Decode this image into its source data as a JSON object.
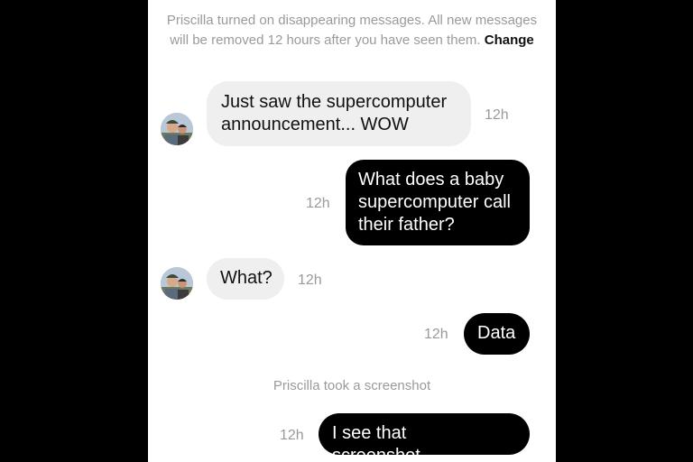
{
  "notice": {
    "text": "Priscilla turned on disappearing messages. All new messages will be removed 12 hours after you have seen them.",
    "action_label": "Change"
  },
  "messages": [
    {
      "sender": "Priscilla",
      "direction": "incoming",
      "text": "Just saw the supercomputer announcement... WOW",
      "time": "12h"
    },
    {
      "sender": "me",
      "direction": "outgoing",
      "text": "What does a baby supercomputer call their father?",
      "time": "12h"
    },
    {
      "sender": "Priscilla",
      "direction": "incoming",
      "text": "What?",
      "time": "12h"
    },
    {
      "sender": "me",
      "direction": "outgoing",
      "text": "Data",
      "time": "12h"
    },
    {
      "sender": "me",
      "direction": "outgoing",
      "text": "I see that screenshot…",
      "time": "12h"
    }
  ],
  "system_event": "Priscilla took a screenshot",
  "colors": {
    "incoming_bubble": "#efefef",
    "outgoing_bubble": "#000000",
    "timestamp": "#9a9a9a",
    "background": "#ffffff"
  }
}
